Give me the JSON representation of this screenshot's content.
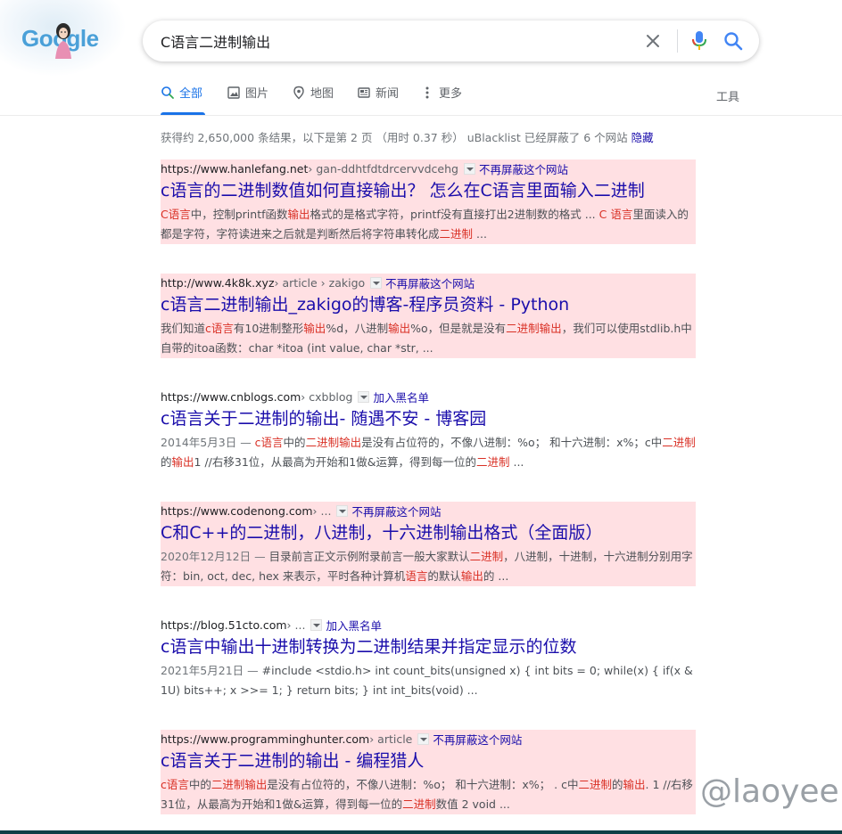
{
  "logo": {
    "text": "Google"
  },
  "search": {
    "query": "C语言二进制输出"
  },
  "tabs": [
    {
      "label": "全部",
      "icon": "search-icon"
    },
    {
      "label": "图片",
      "icon": "image-icon"
    },
    {
      "label": "地图",
      "icon": "map-pin-icon"
    },
    {
      "label": "新闻",
      "icon": "news-icon"
    },
    {
      "label": "更多",
      "icon": "more-icon"
    }
  ],
  "tools_label": "工具",
  "stats": {
    "text": "获得约 2,650,000 条结果，以下是第 2 页 （用时 0.37 秒） uBlacklist 已经屏蔽了 6 个网站 ",
    "hide_link": "隐藏"
  },
  "results": [
    {
      "domain": "https://www.hanlefang.net",
      "path": " › gan-ddhtfdtdrcervvdcehg",
      "action": "不再屏蔽这个网站",
      "title": "c语言的二进制数值如何直接输出？ 怎么在C语言里面输入二进制",
      "date": "",
      "snippet": [
        {
          "t": "C语言",
          "hl": true
        },
        {
          "t": "中，控制printf函数",
          "hl": false
        },
        {
          "t": "输出",
          "hl": true
        },
        {
          "t": "格式的是格式字符，printf没有直接打出2进制数的格式 ... ",
          "hl": false
        },
        {
          "t": "C 语言",
          "hl": true
        },
        {
          "t": "里面读入的都是字符，字符读进来之后就是判断然后将字符串转化成",
          "hl": false
        },
        {
          "t": "二进制",
          "hl": true
        },
        {
          "t": " ...",
          "hl": false
        }
      ],
      "blocked": true
    },
    {
      "domain": "http://www.4k8k.xyz",
      "path": " › article › zakigo",
      "action": "不再屏蔽这个网站",
      "title": "c语言二进制输出_zakigo的博客-程序员资料 - Python",
      "date": "",
      "snippet": [
        {
          "t": "我们知道",
          "hl": false
        },
        {
          "t": "c语言",
          "hl": true
        },
        {
          "t": "有10进制整形",
          "hl": false
        },
        {
          "t": "输出",
          "hl": true
        },
        {
          "t": "%d，八进制",
          "hl": false
        },
        {
          "t": "输出",
          "hl": true
        },
        {
          "t": "%o，但是就是没有",
          "hl": false
        },
        {
          "t": "二进制输出",
          "hl": true
        },
        {
          "t": "，我们可以使用stdlib.h中自带的itoa函数：char *itoa (int value, char *str, ...",
          "hl": false
        }
      ],
      "blocked": true
    },
    {
      "domain": "https://www.cnblogs.com",
      "path": " › cxbblog",
      "action": "加入黑名单",
      "title": "c语言关于二进制的输出- 随遇不安 - 博客园",
      "date": "2014年5月3日 — ",
      "snippet": [
        {
          "t": "c语言",
          "hl": true
        },
        {
          "t": "中的",
          "hl": false
        },
        {
          "t": "二进制输出",
          "hl": true
        },
        {
          "t": "是没有占位符的，不像八进制：%o； 和十六进制：x%；c中",
          "hl": false
        },
        {
          "t": "二进制",
          "hl": true
        },
        {
          "t": "的",
          "hl": false
        },
        {
          "t": "输出",
          "hl": true
        },
        {
          "t": "1 //右移31位，从最高为开始和1做&运算，得到每一位的",
          "hl": false
        },
        {
          "t": "二进制",
          "hl": true
        },
        {
          "t": " ...",
          "hl": false
        }
      ],
      "blocked": false
    },
    {
      "domain": "https://www.codenong.com",
      "path": " › ...",
      "action": "不再屏蔽这个网站",
      "title": "C和C++的二进制，八进制，十六进制输出格式（全面版）",
      "date": "2020年12月12日 — ",
      "snippet": [
        {
          "t": "目录前言正文示例附录前言一般大家默认",
          "hl": false
        },
        {
          "t": "二进制",
          "hl": true
        },
        {
          "t": "，八进制，十进制，十六进制分别用字符：bin, oct, dec, hex 来表示，平时各种计算机",
          "hl": false
        },
        {
          "t": "语言",
          "hl": true
        },
        {
          "t": "的默认",
          "hl": false
        },
        {
          "t": "输出",
          "hl": true
        },
        {
          "t": "的 ...",
          "hl": false
        }
      ],
      "blocked": true
    },
    {
      "domain": "https://blog.51cto.com",
      "path": " › ...",
      "action": "加入黑名单",
      "title": "c语言中输出十进制转换为二进制结果并指定显示的位数",
      "date": "2021年5月21日 — ",
      "snippet": [
        {
          "t": "#include <stdio.h> int count_bits(unsigned x) { int bits = 0; while(x) { if(x & 1U) bits++; x >>= 1; } return bits; } int int_bits(void) ...",
          "hl": false
        }
      ],
      "blocked": false
    },
    {
      "domain": "https://www.programminghunter.com",
      "path": " › article",
      "action": "不再屏蔽这个网站",
      "title": "c语言关于二进制的输出 - 编程猎人",
      "date": "",
      "snippet": [
        {
          "t": "c语言",
          "hl": true
        },
        {
          "t": "中的",
          "hl": false
        },
        {
          "t": "二进制输出",
          "hl": true
        },
        {
          "t": "是没有占位符的，不像八进制：%o； 和十六进制：x%； . c中",
          "hl": false
        },
        {
          "t": "二进制",
          "hl": true
        },
        {
          "t": "的",
          "hl": false
        },
        {
          "t": "输出",
          "hl": true
        },
        {
          "t": ". 1 //右移31位，从最高为开始和1做&运算，得到每一位的",
          "hl": false
        },
        {
          "t": "二进制",
          "hl": true
        },
        {
          "t": "数值 2 void ...",
          "hl": false
        }
      ],
      "blocked": true
    }
  ],
  "watermark": "@laoyee",
  "colors": {
    "link": "#1a0dab",
    "accent": "#1a73e8",
    "highlight": "#d93025",
    "blocked_bg": "#ffe0e3"
  }
}
